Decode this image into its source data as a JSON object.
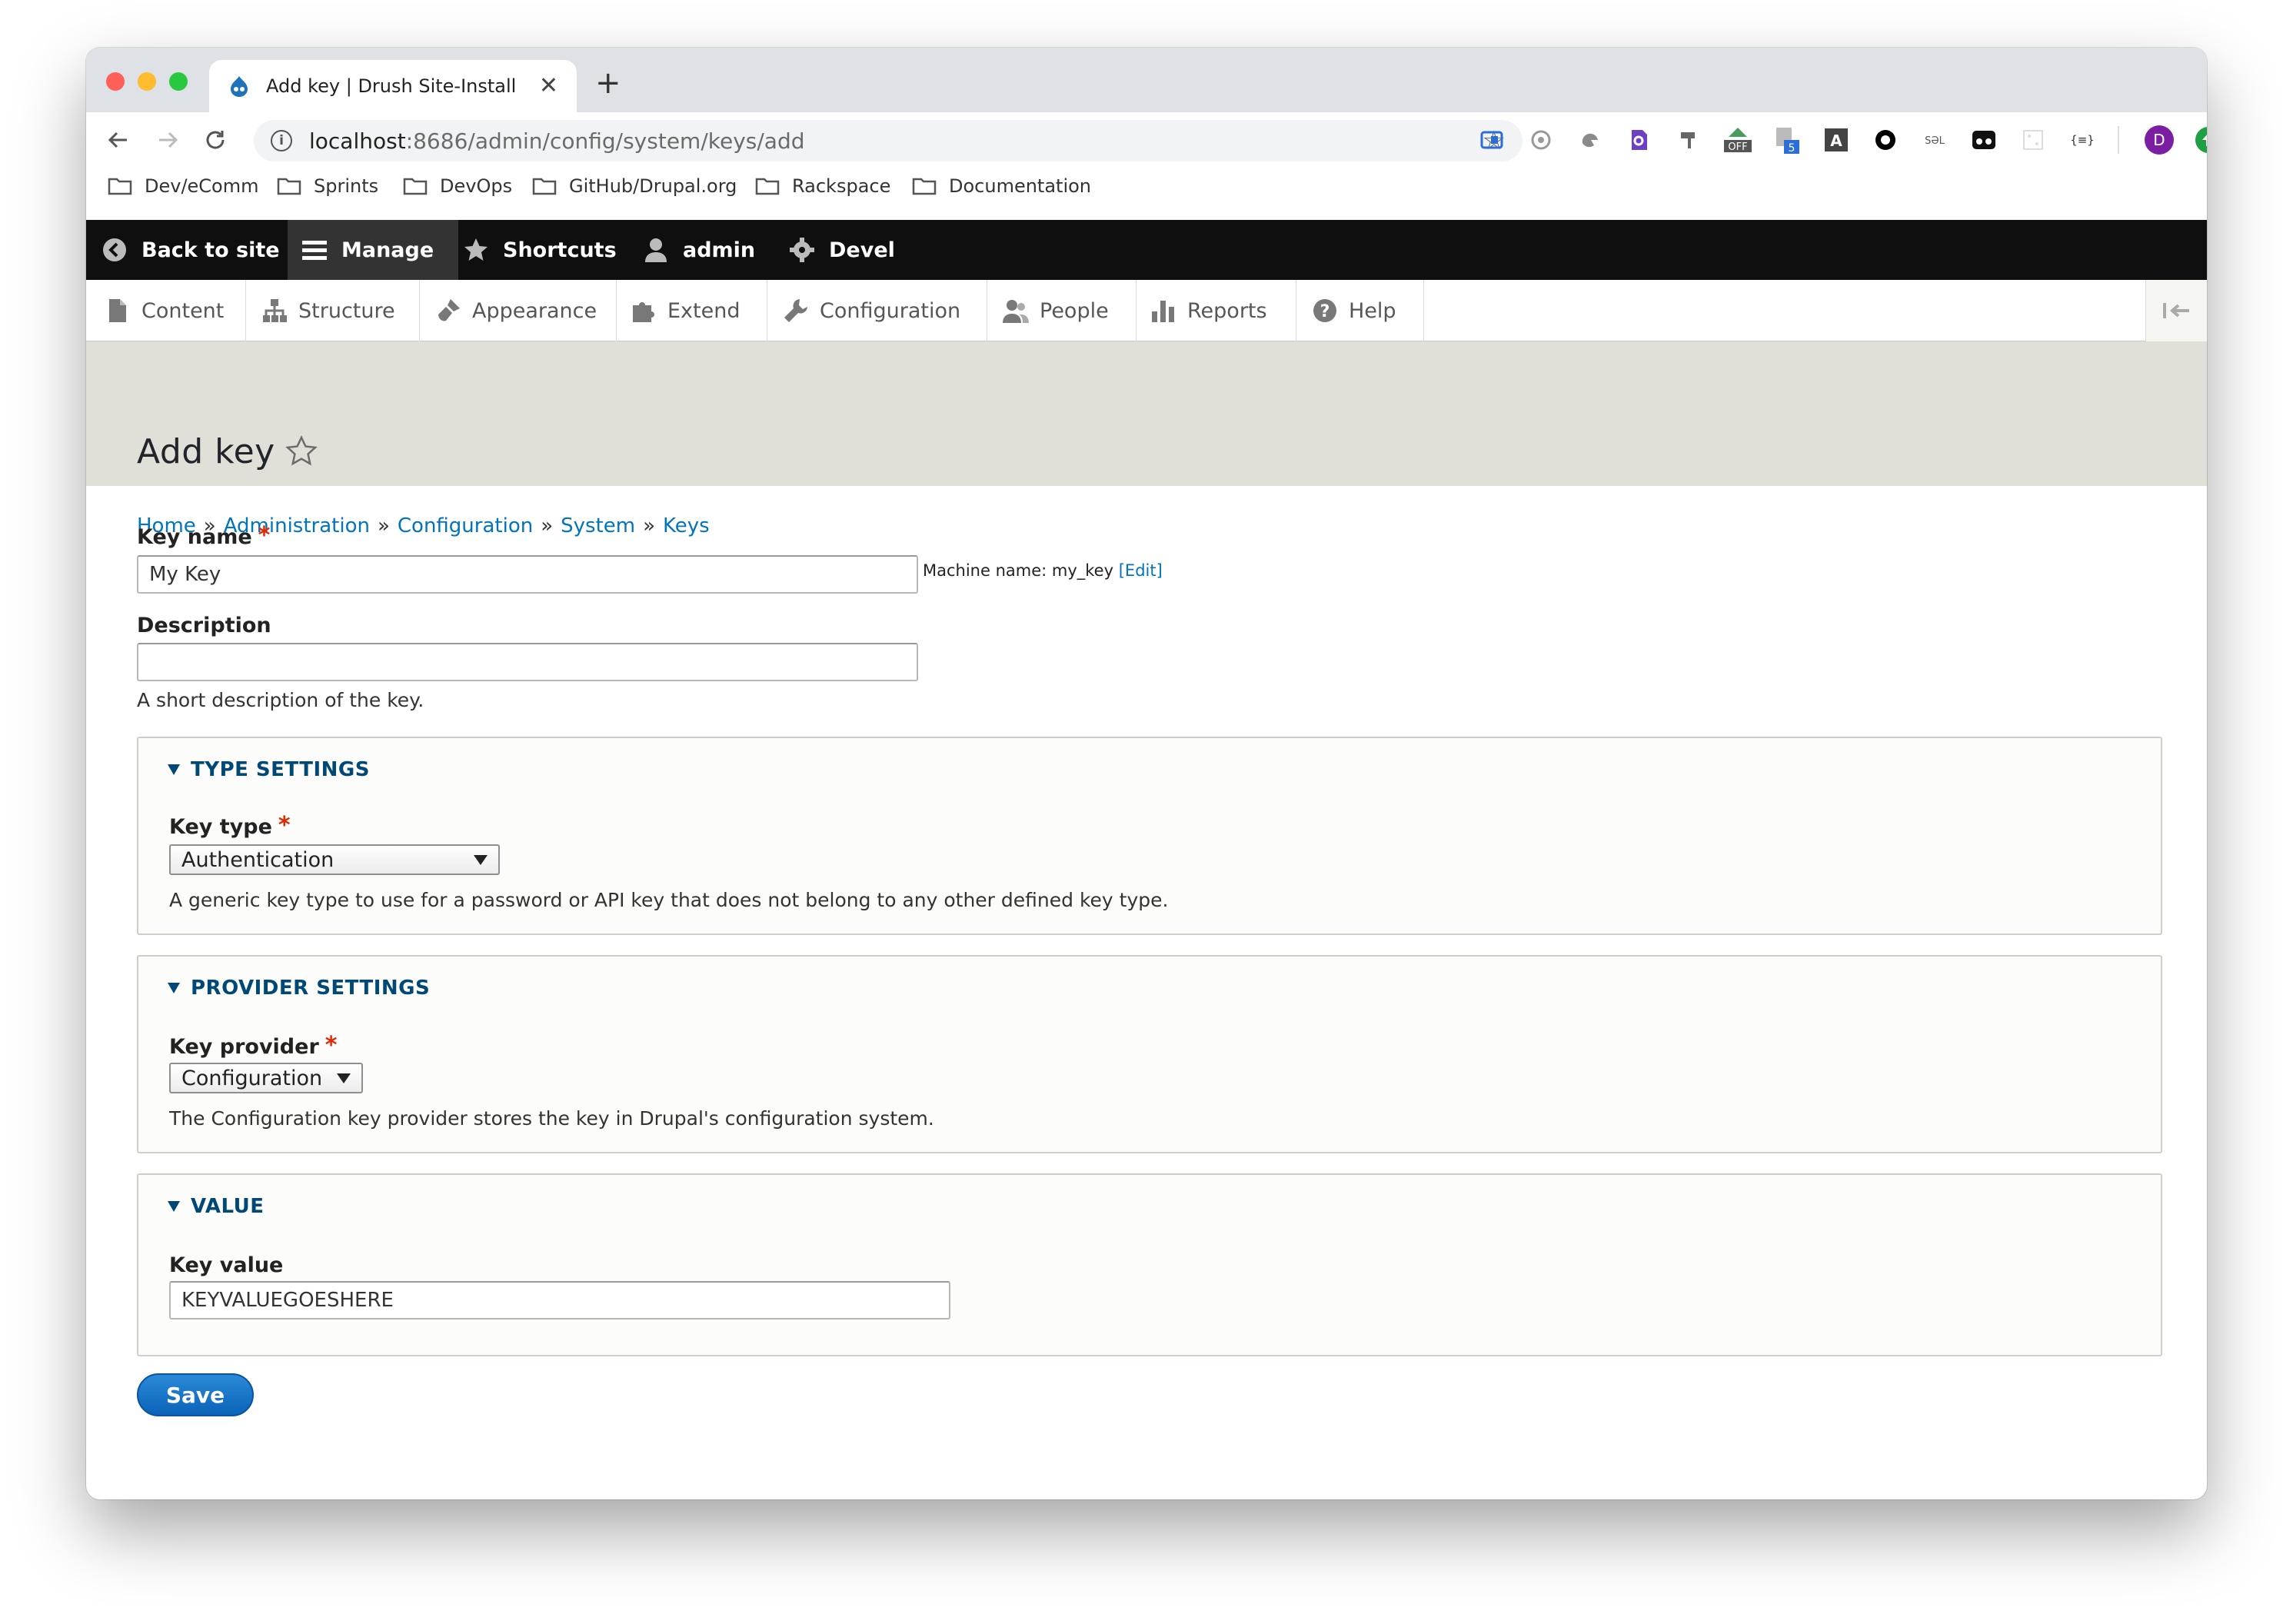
{
  "browser": {
    "tab_title": "Add key | Drush Site-Install",
    "new_tab_label": "+",
    "url_host": "localhost",
    "url_path": ":8686/admin/config/system/keys/add",
    "profile_initial": "D",
    "extensions": [
      "extension-icon",
      "puzzle-icon",
      "ext-icon",
      "search-ext-icon",
      "paint-icon",
      "off-badge-ext",
      "counter-ext",
      "a-ext",
      "circle-ext",
      "sql-ext",
      "glasses-ext",
      "dots-ext",
      "json-ext"
    ],
    "ext_labels": {
      "off": "OFF",
      "counter": "5",
      "a": "A",
      "json": "{≡}",
      "sql": "SƏL"
    },
    "bookmarks": [
      "Dev/eComm",
      "Sprints",
      "DevOps",
      "GitHub/Drupal.org",
      "Rackspace",
      "Documentation"
    ]
  },
  "admin_toolbar": {
    "back_to_site": "Back to site",
    "manage": "Manage",
    "shortcuts": "Shortcuts",
    "user": "admin",
    "devel": "Devel"
  },
  "admin_menu": [
    "Content",
    "Structure",
    "Appearance",
    "Extend",
    "Configuration",
    "People",
    "Reports",
    "Help"
  ],
  "page": {
    "title": "Add key",
    "breadcrumb": [
      "Home",
      "Administration",
      "Configuration",
      "System",
      "Keys"
    ],
    "breadcrumb_separator": "»"
  },
  "form": {
    "key_name_label": "Key name",
    "key_name_value": "My Key",
    "machine_name_prefix": "Machine name: my_key",
    "machine_name_edit": "[Edit]",
    "description_label": "Description",
    "description_value": "",
    "description_help": "A short description of the key.",
    "required_marker": "*",
    "type_settings": {
      "legend": "TYPE SETTINGS",
      "label": "Key type",
      "selected": "Authentication",
      "help": "A generic key type to use for a password or API key that does not belong to any other defined key type."
    },
    "provider_settings": {
      "legend": "PROVIDER SETTINGS",
      "label": "Key provider",
      "selected": "Configuration",
      "help": "The Configuration key provider stores the key in Drupal's configuration system."
    },
    "value_settings": {
      "legend": "VALUE",
      "label": "Key value",
      "value": "KEYVALUEGOESHERE"
    },
    "save_label": "Save"
  },
  "colors": {
    "link": "#0074bd",
    "legend": "#004875",
    "required": "#e32700",
    "admin_bar": "#0f0f0f",
    "page_header": "#e0e0d8",
    "save_button": "#1a7ac9"
  }
}
